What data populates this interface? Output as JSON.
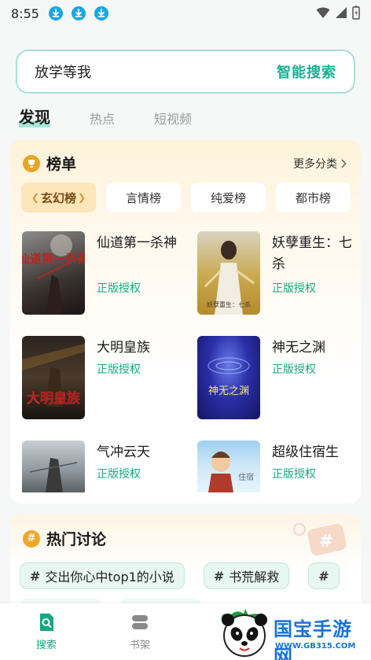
{
  "status_bar": {
    "time": "8:55"
  },
  "search": {
    "query": "放学等我",
    "button": "智能搜索"
  },
  "tabs": [
    {
      "label": "发现",
      "active": true
    },
    {
      "label": "热点",
      "active": false
    },
    {
      "label": "短视频",
      "active": false
    }
  ],
  "ranking": {
    "title": "榜单",
    "more": "更多分类",
    "categories": [
      {
        "label": "玄幻榜",
        "active": true
      },
      {
        "label": "言情榜",
        "active": false
      },
      {
        "label": "纯爱榜",
        "active": false
      },
      {
        "label": "都市榜",
        "active": false
      }
    ],
    "books": [
      {
        "title": "仙道第一杀神",
        "badge": "正版授权",
        "cover_text": "仙道第一杀神"
      },
      {
        "title": "妖孽重生：七杀",
        "badge": "正版授权",
        "cover_text": "妖孽重生：七杀"
      },
      {
        "title": "大明皇族",
        "badge": "正版授权",
        "cover_text": "大明皇族"
      },
      {
        "title": "神无之渊",
        "badge": "正版授权",
        "cover_text": "神无之渊"
      },
      {
        "title": "气冲云天",
        "badge": "正版授权",
        "cover_text": ""
      },
      {
        "title": "超级住宿生",
        "badge": "正版授权",
        "cover_text": "住宿"
      }
    ]
  },
  "discussion": {
    "title": "热门讨论",
    "topics": [
      "交出你心中top1的小说",
      "书荒解救"
    ]
  },
  "bottom_nav": [
    {
      "label": "搜索",
      "active": true,
      "color": "#12a77f"
    },
    {
      "label": "书架",
      "active": false,
      "color": "#8a8a8a"
    }
  ],
  "watermark": {
    "title": "国宝手游网",
    "url": "WWW.GB315.COM"
  },
  "colors": {
    "accent": "#17b093",
    "badge": "#16a97f",
    "download_icon": "#16a7e8",
    "trophy": "#e9a623"
  }
}
